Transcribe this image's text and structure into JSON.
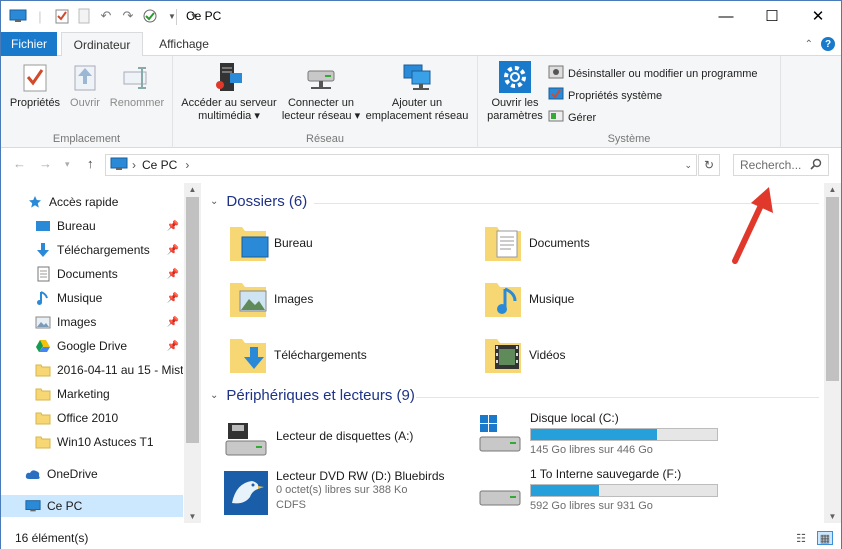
{
  "window": {
    "title": "Ce PC",
    "minimize": "—",
    "maximize": "☐",
    "close": "✕"
  },
  "tabs": {
    "file": "Fichier",
    "computer": "Ordinateur",
    "view": "Affichage"
  },
  "ribbon": {
    "location": {
      "label": "Emplacement",
      "properties": "Propriétés",
      "open": "Ouvrir",
      "rename": "Renommer"
    },
    "network": {
      "label": "Réseau",
      "media_line1": "Accéder au serveur",
      "media_line2": "multimédia",
      "map_line1": "Connecter un",
      "map_line2": "lecteur réseau",
      "add_line1": "Ajouter un",
      "add_line2": "emplacement réseau"
    },
    "system": {
      "label": "Système",
      "settings_line1": "Ouvrir les",
      "settings_line2": "paramètres",
      "uninstall": "Désinstaller ou modifier un programme",
      "sys_props": "Propriétés système",
      "manage": "Gérer"
    }
  },
  "address": {
    "path": "Ce PC",
    "search_placeholder": "Recherch..."
  },
  "navpane": {
    "quick_access": "Accès rapide",
    "items": [
      {
        "label": "Bureau",
        "pinned": true
      },
      {
        "label": "Téléchargements",
        "pinned": true
      },
      {
        "label": "Documents",
        "pinned": true
      },
      {
        "label": "Musique",
        "pinned": true
      },
      {
        "label": "Images",
        "pinned": true
      },
      {
        "label": "Google Drive",
        "pinned": true
      },
      {
        "label": "2016-04-11 au 15 - Mistral",
        "pinned": false
      },
      {
        "label": "Marketing",
        "pinned": false
      },
      {
        "label": "Office 2010",
        "pinned": false
      },
      {
        "label": "Win10 Astuces T1",
        "pinned": false
      }
    ],
    "onedrive": "OneDrive",
    "this_pc": "Ce PC"
  },
  "content": {
    "folders_header": "Dossiers (6)",
    "folders": [
      {
        "label": "Bureau"
      },
      {
        "label": "Documents"
      },
      {
        "label": "Images"
      },
      {
        "label": "Musique"
      },
      {
        "label": "Téléchargements"
      },
      {
        "label": "Vidéos"
      }
    ],
    "devices_header": "Périphériques et lecteurs (9)",
    "devices": [
      {
        "name": "Lecteur de disquettes (A:)",
        "line2": "",
        "line3": "",
        "used_fraction": null
      },
      {
        "name": "Disque local (C:)",
        "line2": "145 Go libres sur 446 Go",
        "line3": "",
        "used_fraction": 0.675
      },
      {
        "name": "Lecteur DVD RW (D:) Bluebirds",
        "line2": "0 octet(s) libres sur 388 Ko",
        "line3": "CDFS",
        "used_fraction": null
      },
      {
        "name": "1 To Interne sauvegarde (F:)",
        "line2": "592 Go libres sur 931 Go",
        "line3": "",
        "used_fraction": 0.364
      }
    ]
  },
  "status": {
    "count": "16 élément(s)"
  },
  "colors": {
    "accent": "#1979ca",
    "progress": "#26a0da",
    "header_blue": "#1e3287",
    "annotation_arrow": "#e0392b"
  }
}
